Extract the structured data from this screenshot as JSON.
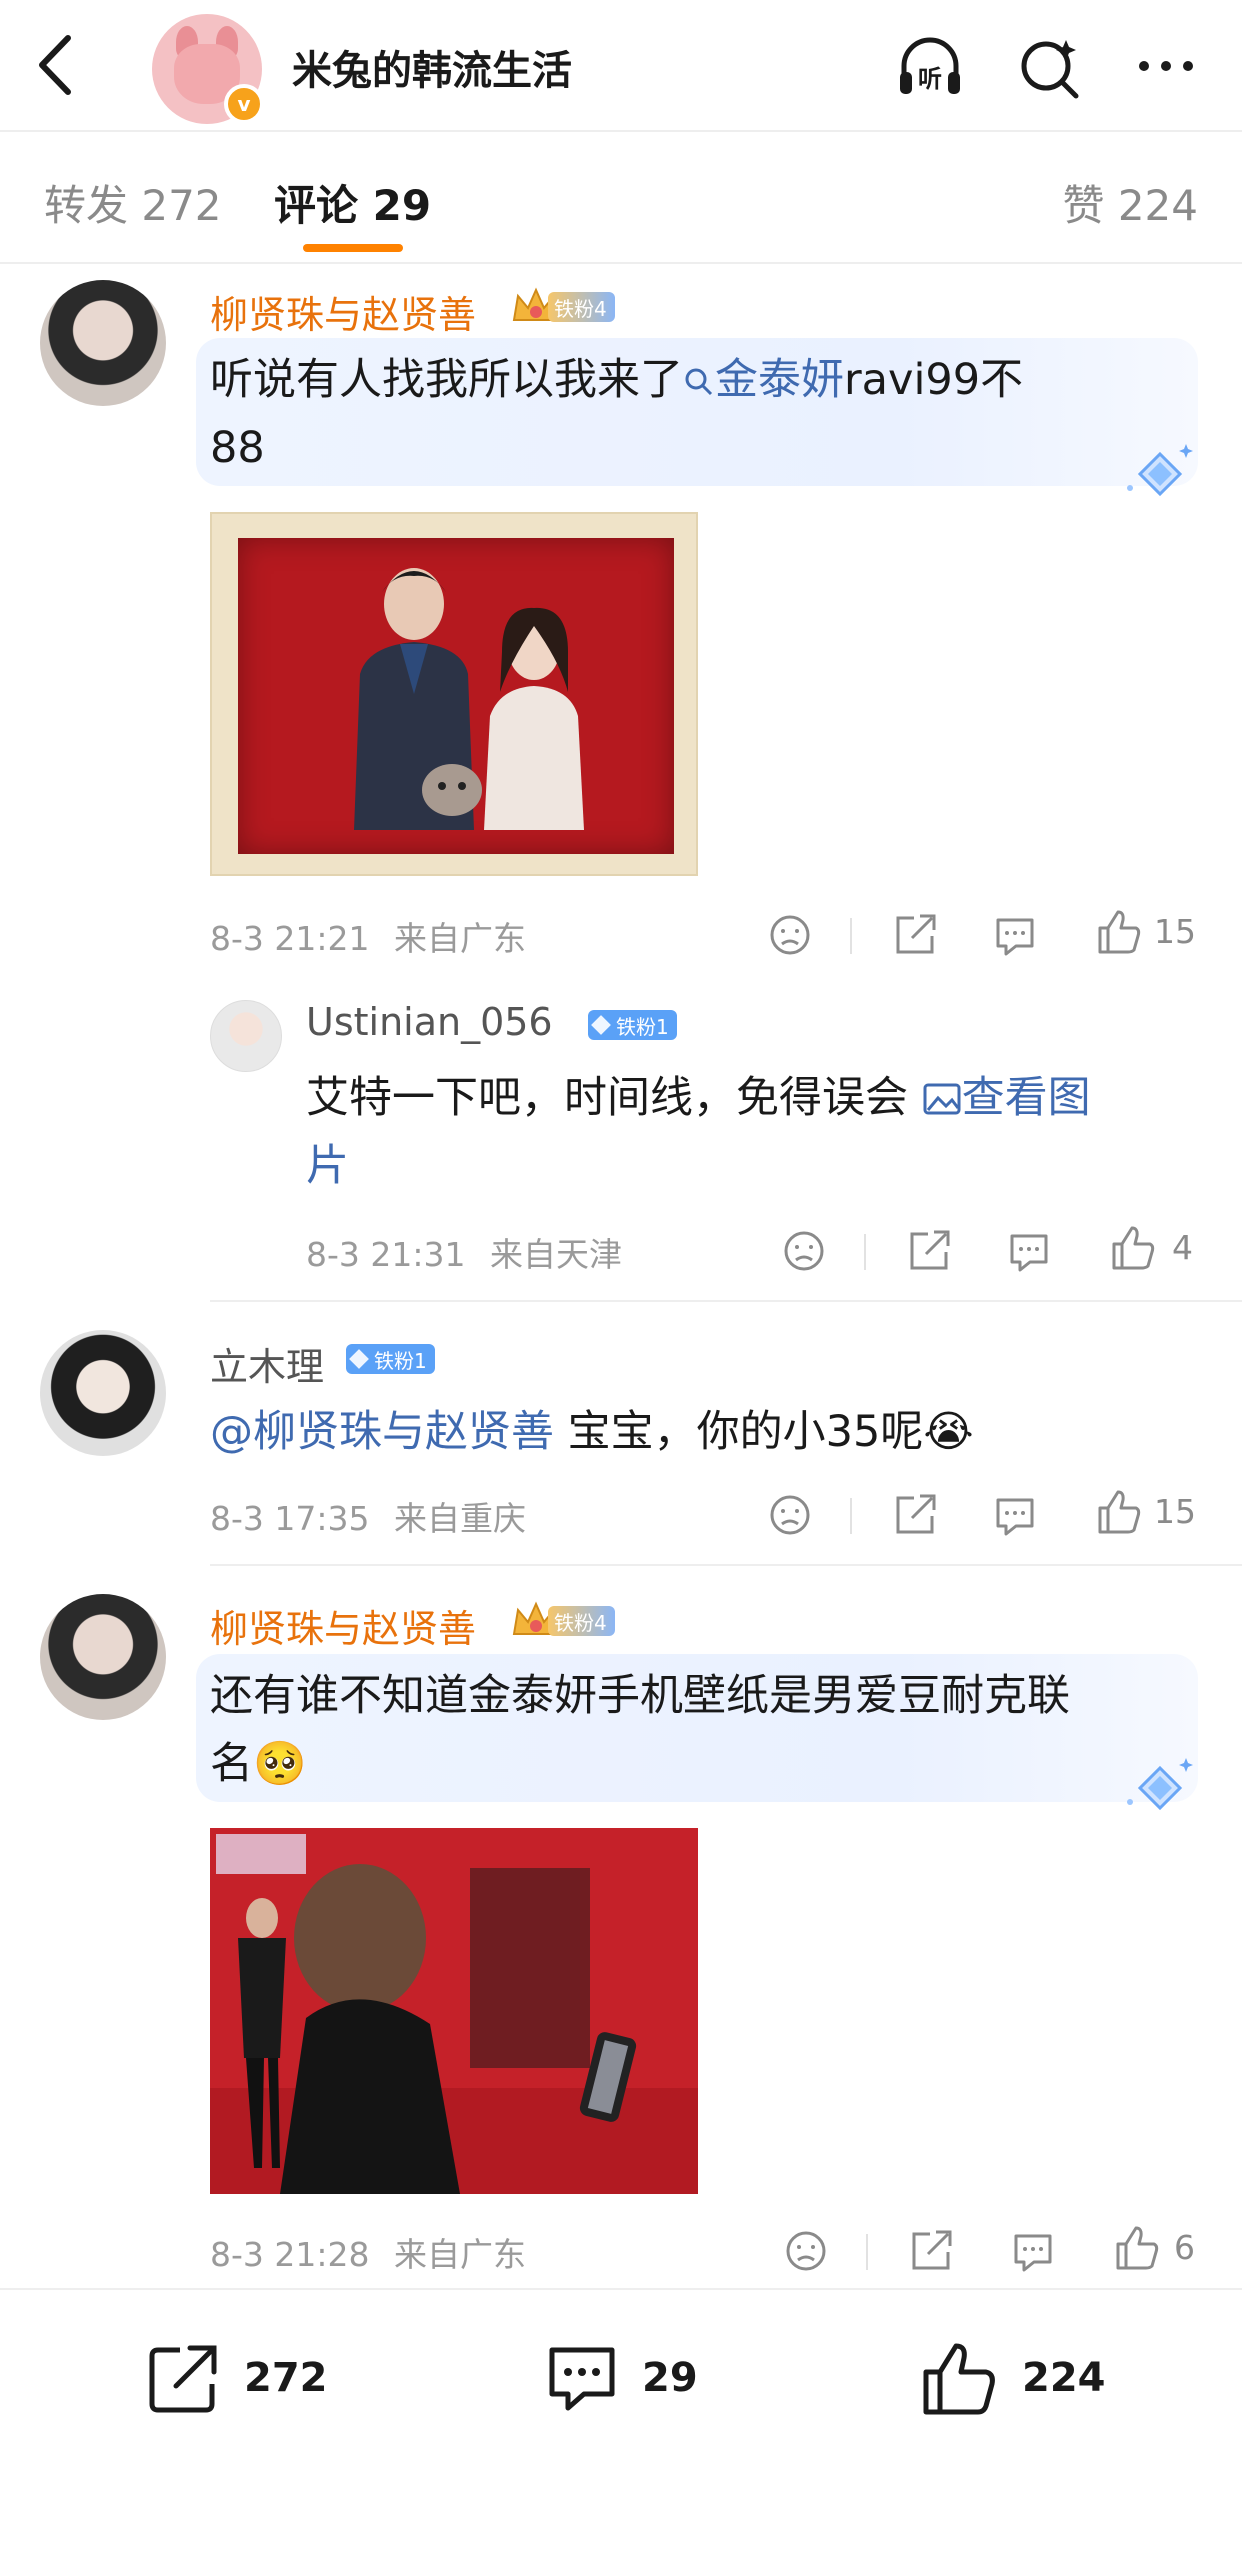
{
  "header": {
    "title": "米兔的韩流生活",
    "listen_label": "听",
    "badge": "v"
  },
  "tabs": {
    "repost": "转发 272",
    "comments": "评论 29",
    "likes": "赞 224"
  },
  "comments": [
    {
      "username": "柳贤珠与赵贤善",
      "badge": "铁粉4",
      "text_line1_pre": "听说有人找我所以我来了",
      "text_line1_link": "金泰妍",
      "text_line1_post": "ravi99不",
      "text_line2": "88",
      "time": "8-3 21:21",
      "location": "来自广东",
      "likes": "15"
    },
    {
      "username": "Ustinian_056",
      "badge": "铁粉1",
      "text_pre": "艾特一下吧，时间线，免得误会",
      "text_link_line1": "查看图",
      "text_link_line2": "片",
      "time": "8-3 21:31",
      "location": "来自天津",
      "likes": "4"
    },
    {
      "username": "立木理",
      "badge": "铁粉1",
      "mention": "@柳贤珠与赵贤善",
      "text": "宝宝，你的小35呢😭",
      "time": "8-3 17:35",
      "location": "来自重庆",
      "likes": "15"
    },
    {
      "username": "柳贤珠与赵贤善",
      "badge": "铁粉4",
      "text_line1": "还有谁不知道金泰妍手机壁纸是男爱豆耐克联",
      "text_line2": "名🥺",
      "time": "8-3 21:28",
      "location": "来自广东",
      "likes": "6"
    }
  ],
  "bottom_bar": {
    "reposts": "272",
    "comments": "29",
    "likes": "224"
  },
  "colors": {
    "accent": "#ff8200",
    "username_orange": "#e8720c",
    "link_blue": "#3f6ab0",
    "badge_blue": "#5aa1f7"
  }
}
